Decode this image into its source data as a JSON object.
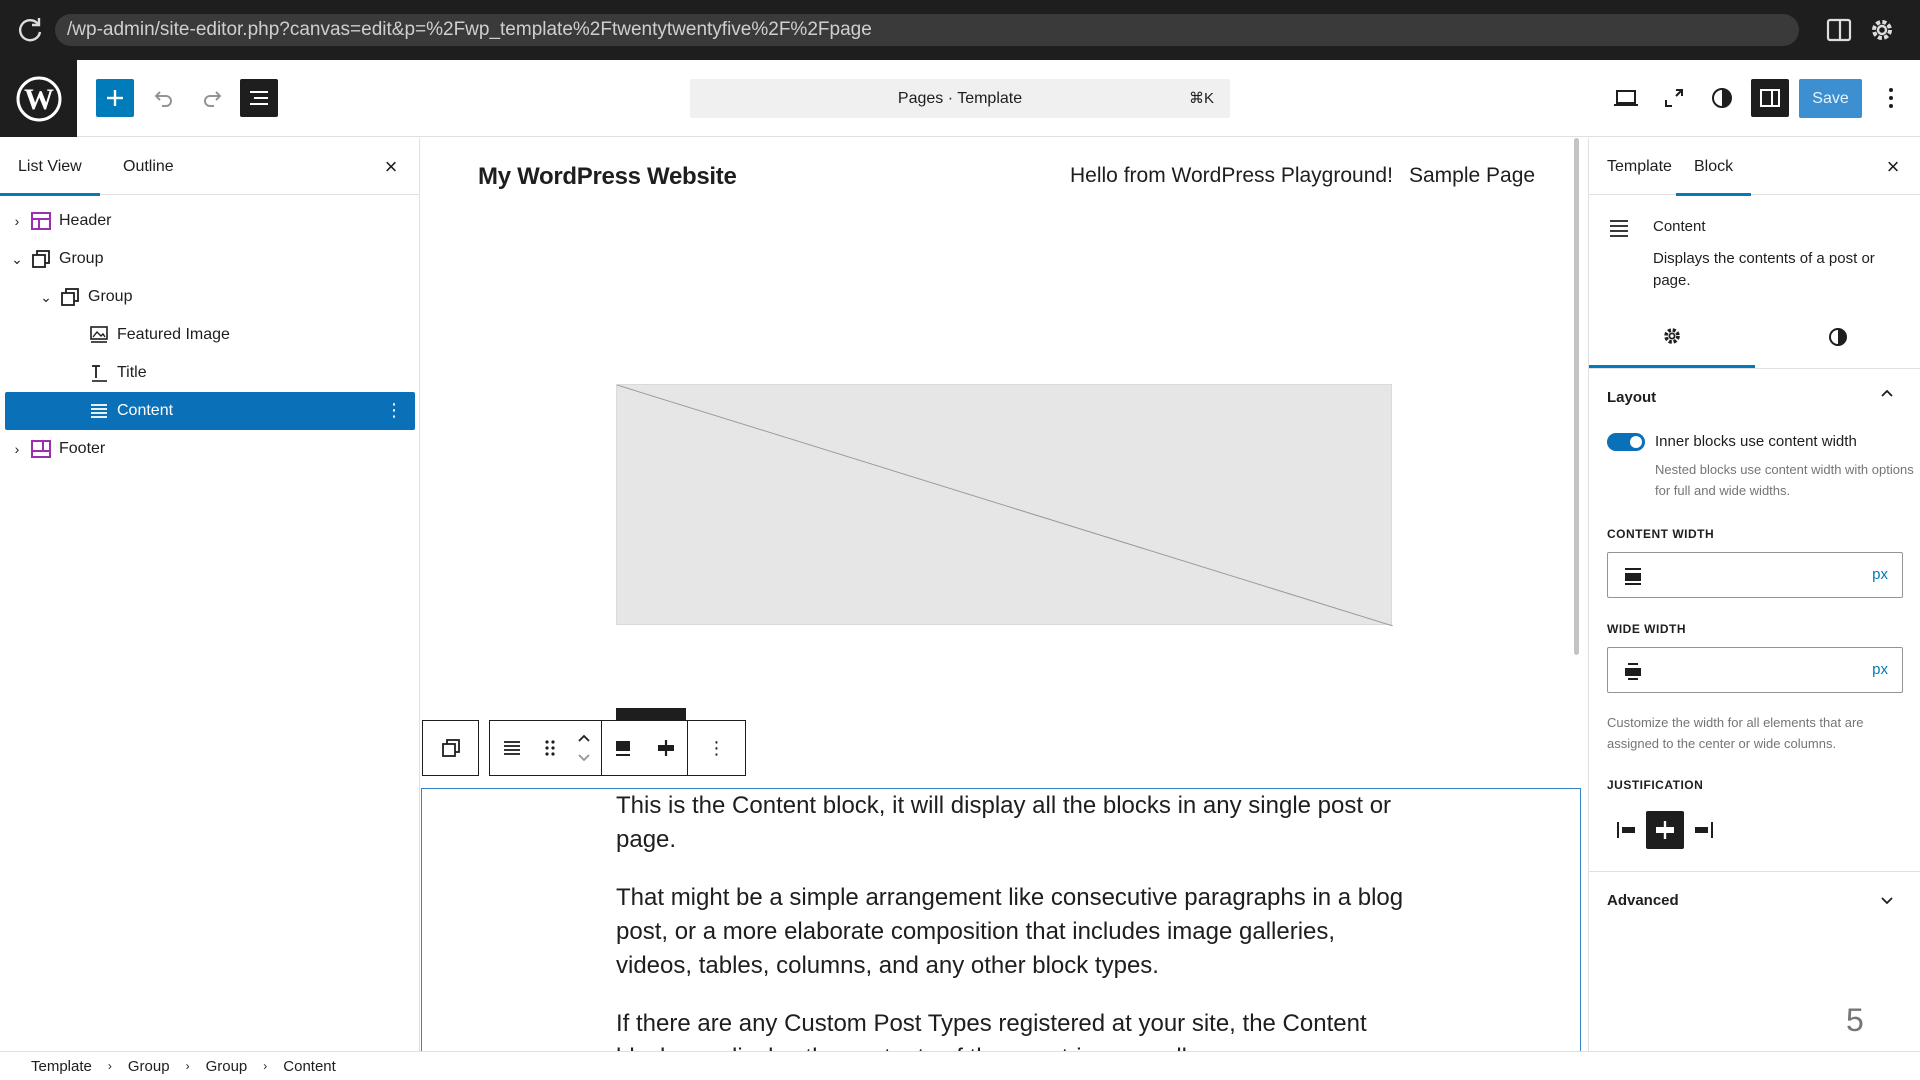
{
  "browser": {
    "url": "/wp-admin/site-editor.php?canvas=edit&p=%2Fwp_template%2Ftwentytwentyfive%2F%2Fpage"
  },
  "toolbar": {
    "command_label": "Pages · Template",
    "command_shortcut": "⌘K",
    "save_label": "Save"
  },
  "list_view": {
    "tabs": [
      "List View",
      "Outline"
    ],
    "items": [
      {
        "label": "Header",
        "icon": "template-part-icon",
        "depth": 0,
        "expanded": false
      },
      {
        "label": "Group",
        "icon": "group-icon",
        "depth": 0,
        "expanded": true
      },
      {
        "label": "Group",
        "icon": "group-icon",
        "depth": 1,
        "expanded": true
      },
      {
        "label": "Featured Image",
        "icon": "featured-image-icon",
        "depth": 2
      },
      {
        "label": "Title",
        "icon": "title-icon",
        "depth": 2
      },
      {
        "label": "Content",
        "icon": "content-icon",
        "depth": 2,
        "selected": true
      },
      {
        "label": "Footer",
        "icon": "template-part-icon",
        "depth": 0,
        "expanded": false
      }
    ]
  },
  "canvas": {
    "site_title": "My WordPress Website",
    "nav": [
      "Hello from WordPress Playground!",
      "Sample Page"
    ],
    "paragraphs": [
      "This is the Content block, it will display all the blocks in any single post or page.",
      "That might be a simple arrangement like consecutive paragraphs in a blog post, or a more elaborate composition that includes image galleries, videos, tables, columns, and any other block types.",
      "If there are any Custom Post Types registered at your site, the Content block can display the contents of those entries as well."
    ]
  },
  "settings": {
    "tabs": [
      "Template",
      "Block"
    ],
    "block_name": "Content",
    "block_desc": "Displays the contents of a post or page.",
    "layout_title": "Layout",
    "toggle_label": "Inner blocks use content width",
    "toggle_help": "Nested blocks use content width with options for full and wide widths.",
    "content_width_label": "CONTENT WIDTH",
    "wide_width_label": "WIDE WIDTH",
    "unit": "px",
    "width_help": "Customize the width for all elements that are assigned to the center or wide columns.",
    "justification_label": "JUSTIFICATION",
    "advanced_title": "Advanced",
    "page_number": "5"
  },
  "breadcrumb": [
    "Template",
    "Group",
    "Group",
    "Content"
  ],
  "colors": {
    "accent": "#007cba",
    "selected": "#0a70b8",
    "dark": "#1e1e1e"
  }
}
